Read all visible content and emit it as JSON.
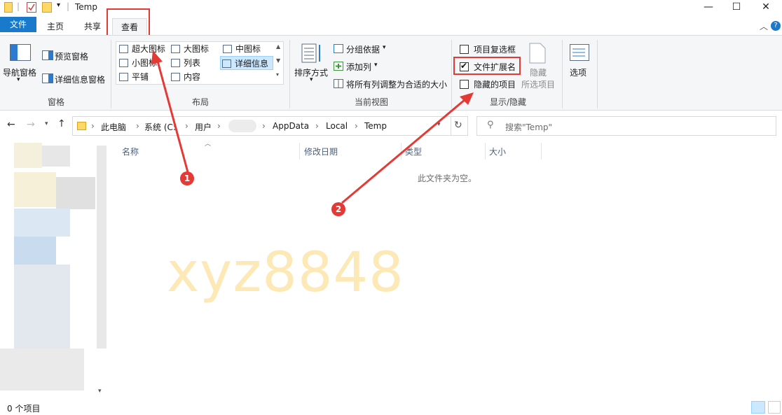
{
  "window": {
    "title": "Temp",
    "minimize": "—",
    "maximize": "☐",
    "close": "✕",
    "help_icon": "?"
  },
  "tabs": {
    "file": "文件",
    "home": "主页",
    "share": "共享",
    "view": "查看"
  },
  "ribbon": {
    "panes": {
      "nav_pane": "导航窗格",
      "preview_pane": "预览窗格",
      "details_pane": "详细信息窗格",
      "group": "窗格"
    },
    "layout": {
      "xlarge": "超大图标",
      "large": "大图标",
      "medium": "中图标",
      "small": "小图标",
      "list": "列表",
      "details": "详细信息",
      "tiles": "平铺",
      "content": "内容",
      "group": "布局"
    },
    "current_view": {
      "sort_by": "排序方式",
      "group_by": "分组依据",
      "add_columns": "添加列",
      "size_all_columns": "将所有列调整为合适的大小",
      "group": "当前视图"
    },
    "show_hide": {
      "item_checkboxes": "项目复选框",
      "file_extensions": "文件扩展名",
      "hidden_items": "隐藏的项目",
      "hide_selected_1": "隐藏",
      "hide_selected_2": "所选项目",
      "group": "显示/隐藏",
      "item_checkboxes_checked": false,
      "file_extensions_checked": true,
      "hidden_items_checked": false
    },
    "options": "选项"
  },
  "address": {
    "crumbs": [
      "此电脑",
      "系统 (C:",
      "用户",
      "AppData",
      "Local",
      "Temp"
    ],
    "search_placeholder": "搜索\"Temp\""
  },
  "columns": {
    "name": "名称",
    "modified": "修改日期",
    "type": "类型",
    "size": "大小"
  },
  "empty_message": "此文件夹为空。",
  "status": "0 个项目",
  "watermark": "xyz8848",
  "markers": {
    "one": "1",
    "two": "2"
  },
  "colors": {
    "accent": "#1979ca",
    "annotation_red": "#e53935",
    "watermark": "#fde9b6"
  }
}
